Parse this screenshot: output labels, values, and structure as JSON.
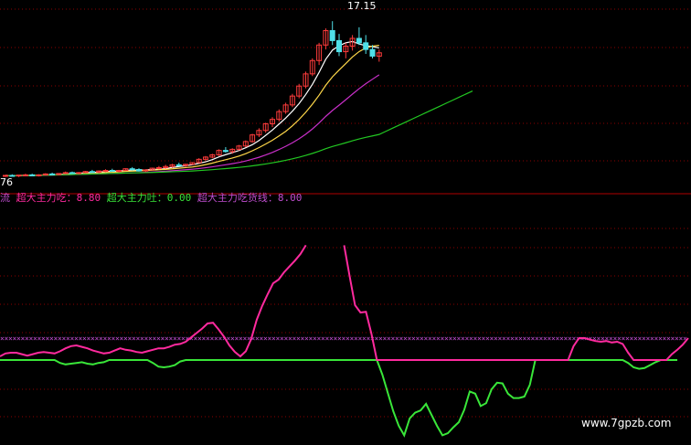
{
  "colors": {
    "background": "#000000",
    "grid": "#8b0000",
    "separator": "#b00000",
    "candle_up": "#ff3b3b",
    "candle_down": "#4fe0e8",
    "ma_short": "#ffffff",
    "ma_mid": "#ffd84a",
    "ma_long": "#c92fc9",
    "ma_trend": "#22c822",
    "chi": "#ff2a9e",
    "tu": "#39e639",
    "huo": "#c04ed0",
    "watermark": "#ffffff"
  },
  "price_panel": {
    "peak_label": "17.15",
    "left_edge_label": "76"
  },
  "legend": {
    "prefix": "流",
    "chi_label": "超大主力吃：",
    "chi_value": "8.80",
    "tu_label": "超大主力吐：",
    "tu_value": "0.00",
    "huo_label": "超大主力吃货线：",
    "huo_value": "8.00"
  },
  "watermark": "www.7gpzb.com",
  "chart_data": [
    {
      "type": "candlestick",
      "panel": "price",
      "annotations": [
        "17.15",
        "76"
      ],
      "candles": [
        [
          3.2,
          3.3,
          3.1,
          3.25
        ],
        [
          3.25,
          3.35,
          3.15,
          3.2
        ],
        [
          3.2,
          3.3,
          3.1,
          3.28
        ],
        [
          3.28,
          3.4,
          3.2,
          3.3
        ],
        [
          3.3,
          3.4,
          3.2,
          3.22
        ],
        [
          3.22,
          3.35,
          3.15,
          3.3
        ],
        [
          3.3,
          3.45,
          3.25,
          3.38
        ],
        [
          3.38,
          3.5,
          3.3,
          3.32
        ],
        [
          3.32,
          3.45,
          3.25,
          3.42
        ],
        [
          3.42,
          3.6,
          3.35,
          3.5
        ],
        [
          3.5,
          3.6,
          3.4,
          3.45
        ],
        [
          3.45,
          3.55,
          3.35,
          3.5
        ],
        [
          3.5,
          3.65,
          3.45,
          3.6
        ],
        [
          3.6,
          3.75,
          3.5,
          3.55
        ],
        [
          3.55,
          3.7,
          3.45,
          3.65
        ],
        [
          3.65,
          3.8,
          3.55,
          3.7
        ],
        [
          3.7,
          3.85,
          3.6,
          3.62
        ],
        [
          3.62,
          3.75,
          3.5,
          3.7
        ],
        [
          3.7,
          3.9,
          3.65,
          3.85
        ],
        [
          3.85,
          4.0,
          3.7,
          3.78
        ],
        [
          3.78,
          3.9,
          3.6,
          3.65
        ],
        [
          3.65,
          3.8,
          3.55,
          3.75
        ],
        [
          3.75,
          3.95,
          3.7,
          3.9
        ],
        [
          3.9,
          4.1,
          3.8,
          3.95
        ],
        [
          3.95,
          4.2,
          3.85,
          4.05
        ],
        [
          4.05,
          4.3,
          3.95,
          4.2
        ],
        [
          4.2,
          4.4,
          4.1,
          4.15
        ],
        [
          4.15,
          4.3,
          4.0,
          4.25
        ],
        [
          4.25,
          4.45,
          4.2,
          4.4
        ],
        [
          4.4,
          4.8,
          4.35,
          4.7
        ],
        [
          4.7,
          5.0,
          4.6,
          4.9
        ],
        [
          4.9,
          5.2,
          4.8,
          5.1
        ],
        [
          5.1,
          5.6,
          5.0,
          5.5
        ],
        [
          5.5,
          5.8,
          5.3,
          5.4
        ],
        [
          5.4,
          5.7,
          5.2,
          5.6
        ],
        [
          5.6,
          6.0,
          5.5,
          5.9
        ],
        [
          5.9,
          6.4,
          5.8,
          6.3
        ],
        [
          6.3,
          7.0,
          6.2,
          6.9
        ],
        [
          6.9,
          7.5,
          6.7,
          7.3
        ],
        [
          7.3,
          8.0,
          7.1,
          7.9
        ],
        [
          7.9,
          8.5,
          7.6,
          8.3
        ],
        [
          8.3,
          9.2,
          8.1,
          9.0
        ],
        [
          9.0,
          9.8,
          8.8,
          9.6
        ],
        [
          9.6,
          10.6,
          9.4,
          10.4
        ],
        [
          10.4,
          11.5,
          10.2,
          11.3
        ],
        [
          11.3,
          12.6,
          11.1,
          12.4
        ],
        [
          12.4,
          13.8,
          12.2,
          13.6
        ],
        [
          13.6,
          15.2,
          13.2,
          15.0
        ],
        [
          15.0,
          16.5,
          14.6,
          16.3
        ],
        [
          16.3,
          17.15,
          15.0,
          15.4
        ],
        [
          15.4,
          16.0,
          14.0,
          14.4
        ],
        [
          14.4,
          15.2,
          13.8,
          14.9
        ],
        [
          14.9,
          15.9,
          14.5,
          15.6
        ],
        [
          15.6,
          16.6,
          15.0,
          15.2
        ],
        [
          15.2,
          15.9,
          14.2,
          14.6
        ],
        [
          14.6,
          15.0,
          13.8,
          14.0
        ],
        [
          14.0,
          14.6,
          13.5,
          14.3
        ]
      ]
    },
    {
      "type": "line",
      "panel": "indicator",
      "series": [
        {
          "name": "超大主力吃",
          "values": [
            0.5,
            0.9,
            1.0,
            1.0,
            0.8,
            0.6,
            0.8,
            1.0,
            1.1,
            1.0,
            0.9,
            1.2,
            1.6,
            1.9,
            2.0,
            1.8,
            1.6,
            1.3,
            1.1,
            0.9,
            1.0,
            1.3,
            1.6,
            1.4,
            1.3,
            1.1,
            1.0,
            1.2,
            1.4,
            1.6,
            1.6,
            1.8,
            2.1,
            2.2,
            2.5,
            3.1,
            3.7,
            4.3,
            5.0,
            5.1,
            4.2,
            3.2,
            2.0,
            1.1,
            0.5,
            1.2,
            2.9,
            5.5,
            7.4,
            9.0,
            10.5,
            11.0,
            12.0,
            12.8,
            13.6,
            14.5,
            15.7,
            null,
            null,
            null,
            null,
            null,
            null,
            15.7,
            11.5,
            7.5,
            6.5,
            6.6,
            3.6,
            0.0,
            0.0,
            0.0,
            0.0,
            0.0,
            0.0,
            0.0,
            0.0,
            0.0,
            0.0,
            0.0,
            0.0,
            0.0,
            0.0,
            0.0,
            0.0,
            0.0,
            0.0,
            0.0,
            0.0,
            0.0,
            0.0,
            0.0,
            0.0,
            0.0,
            0.0,
            0.0,
            0.0,
            0.0,
            0.0,
            0.0,
            0.0,
            0.0,
            0.0,
            0.0,
            0.0,
            1.9,
            3.0,
            3.0,
            2.8,
            2.6,
            2.5,
            2.6,
            2.4,
            2.5,
            2.2,
            1.0,
            0.0,
            0.0,
            0.0,
            0.0,
            0.0,
            0.0,
            0.0,
            0.8,
            1.4,
            2.1,
            3.0
          ]
        },
        {
          "name": "超大主力吐",
          "values": [
            0.0,
            0.0,
            0.0,
            0.0,
            0.0,
            0.0,
            0.0,
            0.0,
            0.0,
            0.0,
            0.0,
            -0.4,
            -0.6,
            -0.5,
            -0.4,
            -0.3,
            -0.5,
            -0.6,
            -0.4,
            -0.3,
            0.0,
            0.0,
            0.0,
            0.0,
            0.0,
            0.0,
            0.0,
            0.0,
            -0.4,
            -0.9,
            -1.0,
            -0.9,
            -0.7,
            -0.2,
            0.0,
            0.0,
            0.0,
            0.0,
            0.0,
            0.0,
            0.0,
            0.0,
            0.0,
            0.0,
            0.0,
            0.0,
            0.0,
            0.0,
            0.0,
            0.0,
            0.0,
            0.0,
            0.0,
            0.0,
            0.0,
            0.0,
            0.0,
            0.0,
            0.0,
            0.0,
            0.0,
            0.0,
            0.0,
            0.0,
            0.0,
            0.0,
            0.0,
            0.0,
            0.0,
            0.0,
            -2.0,
            -4.5,
            -7.0,
            -9.0,
            -10.3,
            -8.0,
            -7.2,
            -6.9,
            -6.0,
            -7.5,
            -9.0,
            -10.3,
            -10.0,
            -9.2,
            -8.5,
            -6.8,
            -4.3,
            -4.6,
            -6.3,
            -5.9,
            -4.0,
            -3.1,
            -3.2,
            -4.6,
            -5.2,
            -5.2,
            -5.0,
            -3.4,
            0.0,
            0.0,
            0.0,
            0.0,
            0.0,
            0.0,
            0.0,
            0.0,
            0.0,
            0.0,
            0.0,
            0.0,
            0.0,
            0.0,
            0.0,
            0.0,
            0.0,
            -0.4,
            -1.0,
            -1.2,
            -1.1,
            -0.7,
            -0.3,
            0.0,
            0.0,
            0.0,
            0.0
          ]
        },
        {
          "name": "超大主力吃货线",
          "constant": 3.0
        }
      ]
    }
  ]
}
